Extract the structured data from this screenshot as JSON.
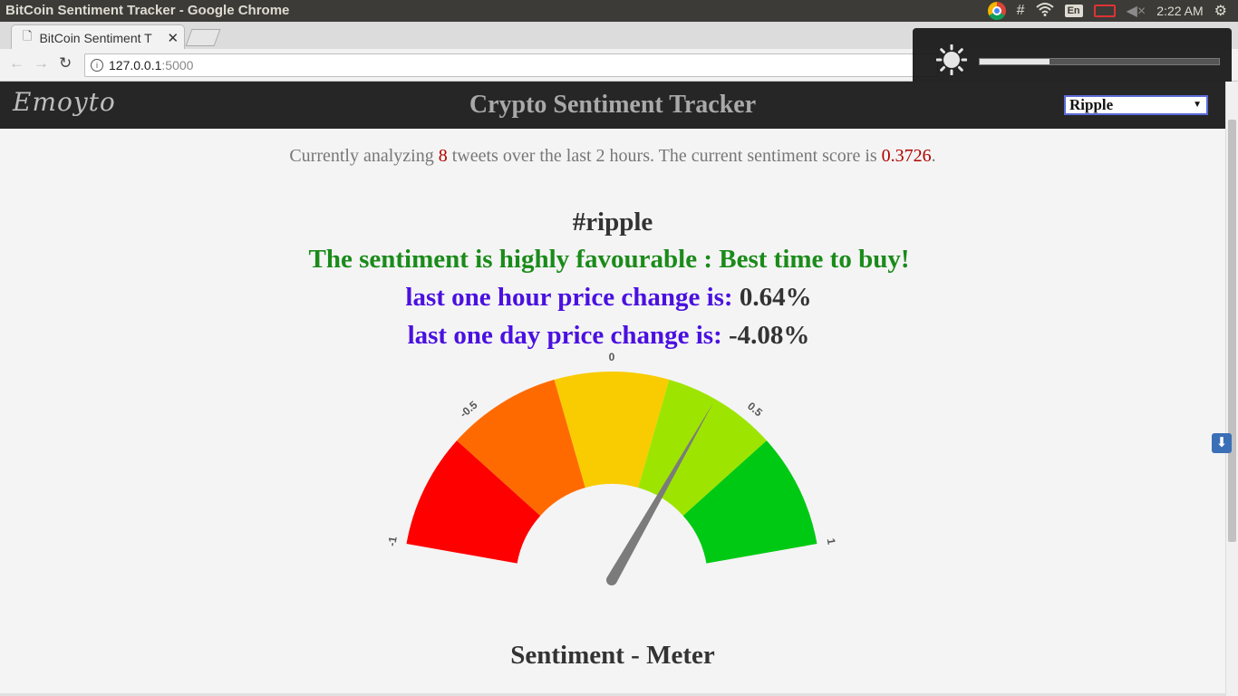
{
  "os": {
    "window_title": "BitCoin Sentiment Tracker - Google Chrome",
    "keyboard_layout": "En",
    "clock": "2:22 AM"
  },
  "browser": {
    "tab_title": "BitCoin Sentiment T",
    "url_host": "127.0.0.1",
    "url_port": ":5000"
  },
  "osd": {
    "brightness_level": 0.29
  },
  "app": {
    "logo": "Emoyto",
    "title": "Crypto Sentiment Tracker",
    "selected_coin": "Ripple"
  },
  "summary": {
    "prefix": "Currently analyzing ",
    "tweet_count": "8",
    "middle": " tweets over the last 2 hours. The current sentiment score is ",
    "score": "0.3726",
    "suffix": "."
  },
  "hashtag": "#ripple",
  "verdict": "The sentiment is highly favourable : Best time to buy!",
  "hour_change": {
    "label": "last one hour price change is:",
    "value": "0.64%"
  },
  "day_change": {
    "label": "last one day price change is:",
    "value": "-4.08%"
  },
  "gauge": {
    "min": -1,
    "max": 1,
    "value": 0.3726,
    "tick_labels": [
      "-1",
      "-0.5",
      "0",
      "0.5",
      "1"
    ],
    "band_colors": [
      "#ff0000",
      "#ff6a00",
      "#f8cc00",
      "#9de500",
      "#00c914"
    ],
    "needle_color": "#7b7b7b"
  },
  "meter_title": "Sentiment - Meter"
}
